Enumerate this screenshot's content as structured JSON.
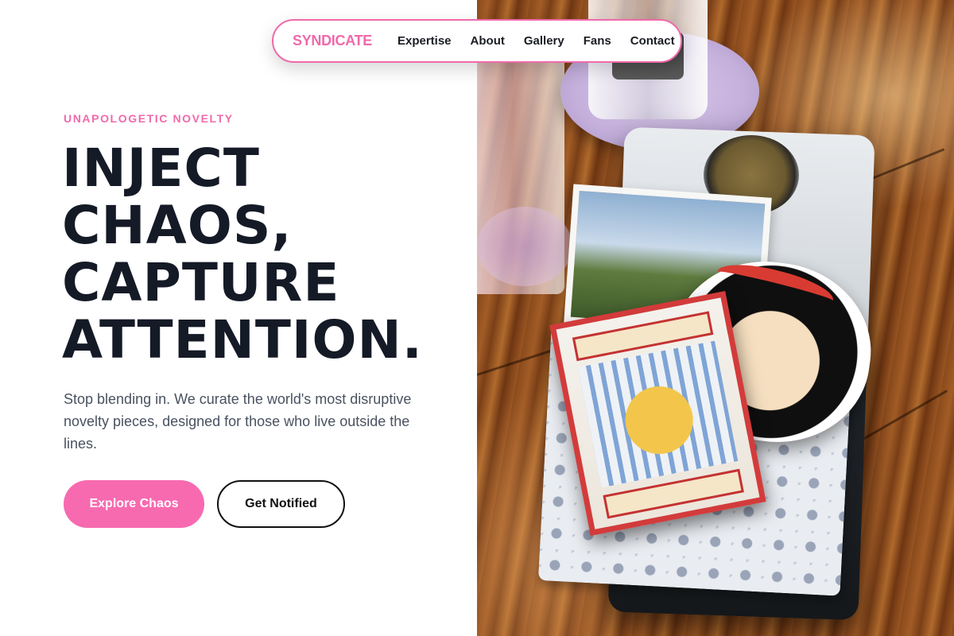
{
  "nav": {
    "brand": "SYNDICATE",
    "links": [
      "Expertise",
      "About",
      "Gallery",
      "Fans",
      "Contact"
    ]
  },
  "hero": {
    "eyebrow": "UNAPOLOGETIC NOVELTY",
    "headline_lines": [
      "INJECT",
      "CHAOS,",
      "CAPTURE",
      "ATTENTION."
    ],
    "lede": "Stop blending in. We curate the world's most disruptive novelty pieces, designed for those who live outside the lines.",
    "primary_button": "Explore Chaos",
    "secondary_button": "Get Notified"
  },
  "colors": {
    "accent_pink": "#f06aab",
    "button_pink": "#f76ab0",
    "headline_navy": "#151a27",
    "body_gray": "#4a5260"
  }
}
